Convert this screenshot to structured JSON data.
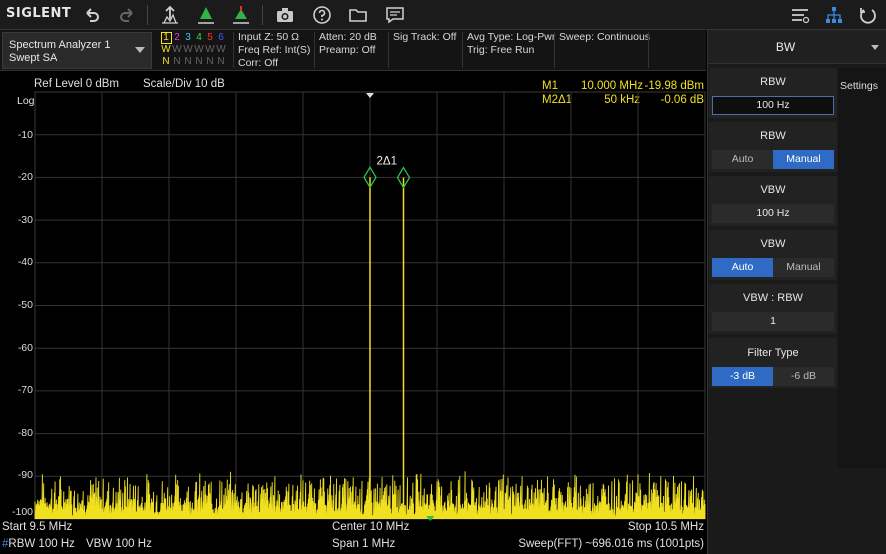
{
  "toolbar": {
    "logo": "SIGLENT",
    "icons": [
      "undo-icon",
      "redo-icon",
      "peak-search-icon",
      "marker-icon",
      "marker-delta-icon",
      "camera-icon",
      "help-icon",
      "folder-icon",
      "message-icon",
      "menu-icon",
      "network-icon",
      "power-icon"
    ]
  },
  "infobar": {
    "mode_name": "Spectrum Analyzer 1",
    "mode_sub": "Swept SA",
    "trace_numbers": [
      "1",
      "2",
      "3",
      "4",
      "5",
      "6"
    ],
    "trace_colors": [
      "#f0e020",
      "#e040e0",
      "#40c0ff",
      "#30e040",
      "#ff3030",
      "#4060ff"
    ],
    "trace_modes": [
      "W",
      "W",
      "W",
      "W",
      "W",
      "W"
    ],
    "trace_det": [
      "N",
      "N",
      "N",
      "N",
      "N",
      "N"
    ],
    "input_z": "Input Z: 50 Ω",
    "freq_ref": "Freq Ref: Int(S)",
    "corr": "Corr: Off",
    "atten": "Atten: 20 dB",
    "preamp": "Preamp: Off",
    "sig_track": "Sig Track: Off",
    "avg_type": "Avg Type: Log-Pwr",
    "trig": "Trig: Free Run",
    "sweep": "Sweep: Continuous"
  },
  "plot": {
    "ref_level": "Ref Level  0 dBm",
    "scale": "Scale/Div  10 dB",
    "log_label": "Log",
    "y_labels": [
      "-10",
      "-20",
      "-30",
      "-40",
      "-50",
      "-60",
      "-70",
      "-80",
      "-90",
      "-100"
    ],
    "marker1_name": "M1",
    "marker1_freq": "10.000 MHz",
    "marker1_val": "-19.98 dBm",
    "marker2_name": "M2Δ1",
    "marker2_freq": "50 kHz",
    "marker2_val": "-0.06 dB",
    "marker_label": "2Δ1",
    "start": "Start  9.5 MHz",
    "center": "Center  10 MHz",
    "stop": "Stop  10.5 MHz",
    "rbw_prefix": "#",
    "rbw": "RBW  100 Hz",
    "vbw": "VBW  100 Hz",
    "span": "Span  1 MHz",
    "sweep_time": "Sweep(FFT)  ~696.016 ms (1001pts)"
  },
  "chart_data": {
    "type": "line",
    "xlim": [
      9.5,
      10.5
    ],
    "ylim": [
      -100,
      0
    ],
    "xunit": "MHz",
    "yunit": "dBm",
    "noise_floor": -95,
    "peaks": [
      {
        "x": 10.0,
        "y": -19.98
      },
      {
        "x": 10.05,
        "y": -20.04
      }
    ],
    "trace_color": "#f0e020",
    "grid": true
  },
  "panel": {
    "title": "BW",
    "settings_tab": "Settings",
    "rbw_label": "RBW",
    "rbw_value": "100 Hz",
    "rbw_mode_label": "RBW",
    "rbw_auto": "Auto",
    "rbw_manual": "Manual",
    "vbw_label": "VBW",
    "vbw_value": "100 Hz",
    "vbw_mode_label": "VBW",
    "vbw_auto": "Auto",
    "vbw_manual": "Manual",
    "ratio_label": "VBW : RBW",
    "ratio_value": "1",
    "filter_label": "Filter Type",
    "filter_3db": "-3 dB",
    "filter_6db": "-6 dB"
  }
}
